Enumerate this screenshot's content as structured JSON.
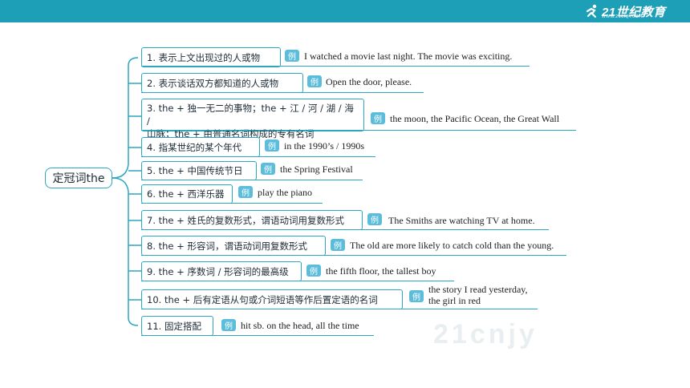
{
  "header": {
    "logo_text": "21世纪教育",
    "logo_sub": "WWW.21CNJY.COM"
  },
  "mindmap": {
    "root": "定冠词the",
    "tag_label": "例",
    "branches": [
      {
        "label": "1. 表示上文出现过的人或物",
        "example": "I watched a movie last night. The movie was exciting."
      },
      {
        "label": "2. 表示谈话双方都知道的人或物",
        "example": "Open the door, please."
      },
      {
        "label_lines": [
          "3. the + 独一无二的事物；the + 江 / 河 / 湖 / 海 /",
          "山脉；the + 由普通名词构成的专有名词"
        ],
        "example": "the moon, the Pacific Ocean, the Great Wall"
      },
      {
        "label": "4. 指某世纪的某个年代",
        "example": "in the 1990’s / 1990s"
      },
      {
        "label": "5. the + 中国传统节日",
        "example": "the Spring Festival"
      },
      {
        "label": "6. the + 西洋乐器",
        "example": "play the piano"
      },
      {
        "label": "7. the + 姓氏的复数形式，谓语动词用复数形式",
        "example": "The Smiths are watching TV at home."
      },
      {
        "label": "8. the + 形容词，谓语动词用复数形式",
        "example": "The old are more likely to catch cold than the young."
      },
      {
        "label": "9. the + 序数词 / 形容词的最高级",
        "example": "the fifth floor, the tallest boy"
      },
      {
        "label": "10. the + 后有定语从句或介词短语等作后置定语的名词",
        "example_lines": [
          "the story I read yesterday,",
          "the girl in red"
        ]
      },
      {
        "label": "11. 固定搭配",
        "example": "hit sb. on the head, all the time"
      }
    ]
  },
  "watermark": "21cnjy",
  "colors": {
    "header": "#1e9fb8",
    "accent": "#2ba7c0",
    "tag": "#5cbddb"
  }
}
